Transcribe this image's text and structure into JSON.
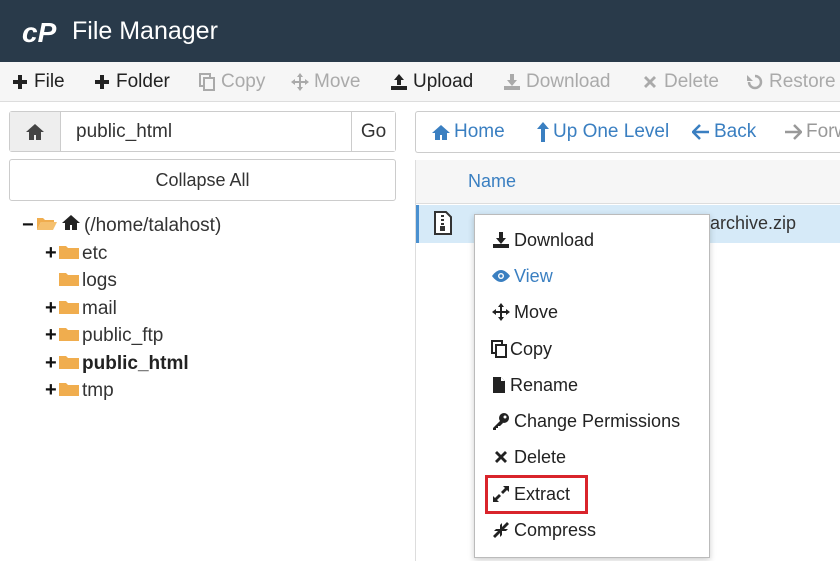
{
  "app": {
    "title": "File Manager",
    "logo": "cP"
  },
  "toolbar": [
    {
      "label": "File",
      "icon": "plus-icon",
      "enabled": true
    },
    {
      "label": "Folder",
      "icon": "plus-icon",
      "enabled": true
    },
    {
      "label": "Copy",
      "icon": "copy-icon",
      "enabled": false
    },
    {
      "label": "Move",
      "icon": "move-icon",
      "enabled": false
    },
    {
      "label": "Upload",
      "icon": "upload-icon",
      "enabled": true
    },
    {
      "label": "Download",
      "icon": "download-icon",
      "enabled": false
    },
    {
      "label": "Delete",
      "icon": "delete-icon",
      "enabled": false
    },
    {
      "label": "Restore",
      "icon": "restore-icon",
      "enabled": false
    }
  ],
  "path": {
    "value": "public_html",
    "go_label": "Go"
  },
  "collapse_label": "Collapse All",
  "tree": {
    "root": "(/home/talahost)",
    "items": [
      {
        "label": "etc",
        "expandable": true,
        "selected": false
      },
      {
        "label": "logs",
        "expandable": false,
        "selected": false
      },
      {
        "label": "mail",
        "expandable": true,
        "selected": false
      },
      {
        "label": "public_ftp",
        "expandable": true,
        "selected": false
      },
      {
        "label": "public_html",
        "expandable": true,
        "selected": true
      },
      {
        "label": "tmp",
        "expandable": true,
        "selected": false
      }
    ]
  },
  "nav": [
    {
      "label": "Home",
      "icon": "home-icon"
    },
    {
      "label": "Up One Level",
      "icon": "up-arrow-icon"
    },
    {
      "label": "Back",
      "icon": "back-arrow-icon"
    },
    {
      "label": "Forw",
      "icon": "forward-arrow-icon"
    }
  ],
  "filelist": {
    "column_name": "Name",
    "files": [
      {
        "name": "archive.zip",
        "icon": "zip-file-icon",
        "selected": true
      }
    ]
  },
  "context_menu": [
    {
      "label": "Download",
      "icon": "download-icon"
    },
    {
      "label": "View",
      "icon": "eye-icon"
    },
    {
      "label": "Move",
      "icon": "move-icon"
    },
    {
      "label": "Copy",
      "icon": "copy-icon"
    },
    {
      "label": "Rename",
      "icon": "file-icon"
    },
    {
      "label": "Change Permissions",
      "icon": "key-icon"
    },
    {
      "label": "Delete",
      "icon": "close-icon"
    },
    {
      "label": "Extract",
      "icon": "expand-icon",
      "highlighted": true
    },
    {
      "label": "Compress",
      "icon": "compress-icon"
    }
  ],
  "colors": {
    "header_bg": "#293a4a",
    "link_blue": "#3a7fc1",
    "selection_bg": "#d6eaf8",
    "highlight_red": "#d9242b"
  }
}
